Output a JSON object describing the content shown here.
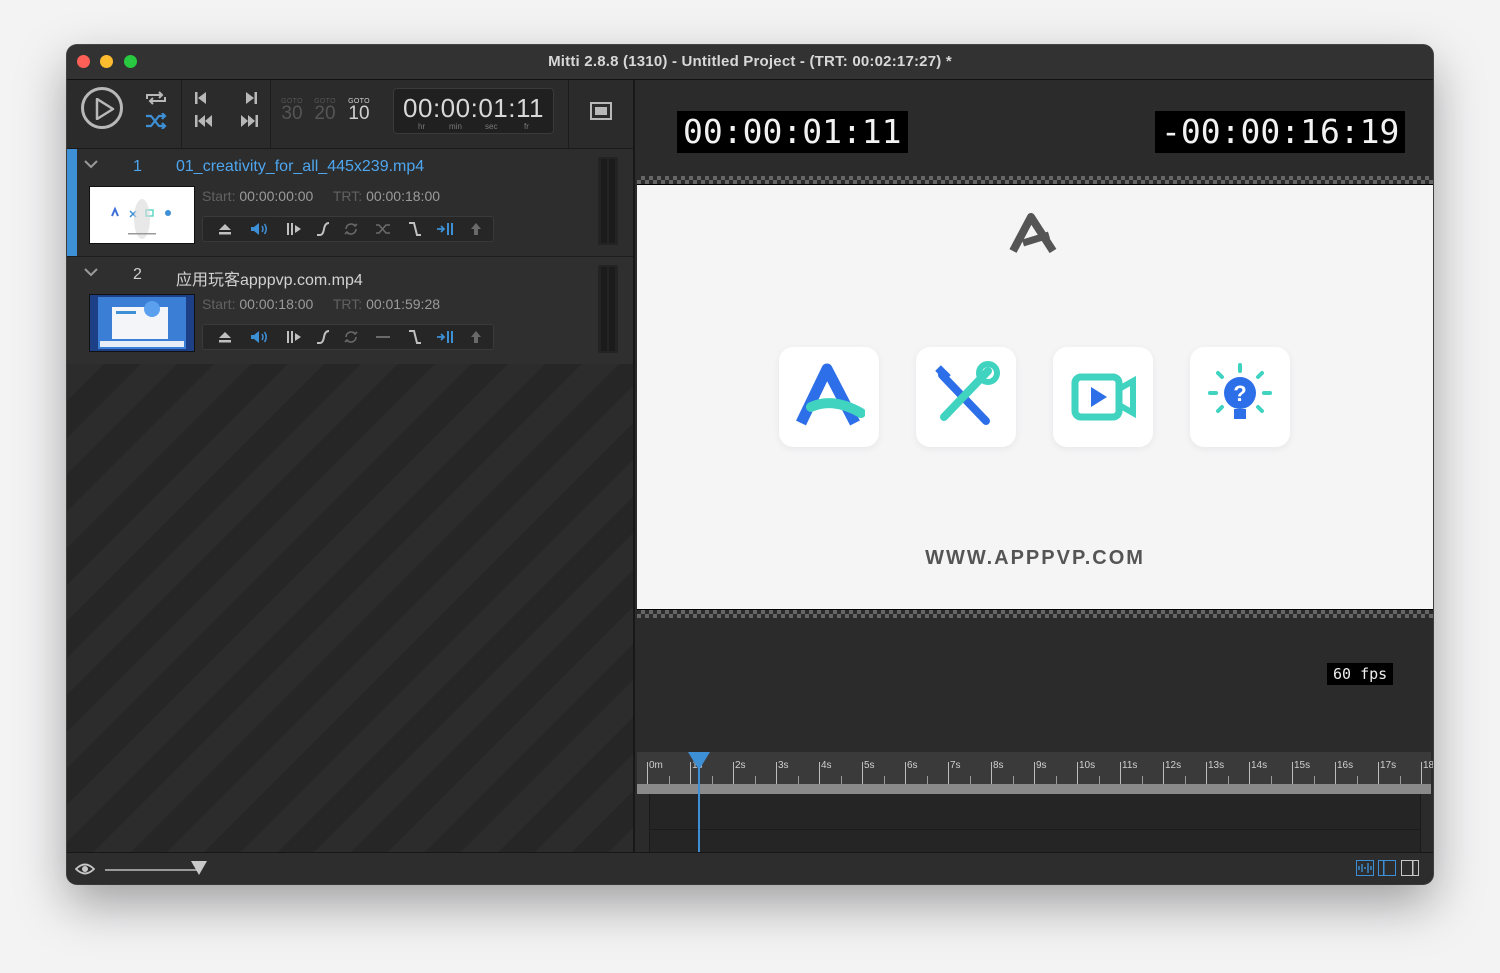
{
  "window": {
    "title": "Mitti 2.8.8 (1310) - Untitled Project - (TRT: 00:02:17:27) *"
  },
  "toolbar": {
    "goto": [
      {
        "label": "GOTO",
        "value": "30"
      },
      {
        "label": "GOTO",
        "value": "20"
      },
      {
        "label": "GOTO",
        "value": "10"
      }
    ],
    "timecode": "00:00:01:11",
    "units": {
      "hr": "hr",
      "min": "min",
      "sec": "sec",
      "fr": "fr"
    }
  },
  "cues": [
    {
      "number": "1",
      "filename": "01_creativity_for_all_445x239.mp4",
      "start_label": "Start:",
      "start": "00:00:00:00",
      "trt_label": "TRT:",
      "trt": "00:00:18:00",
      "selected": true
    },
    {
      "number": "2",
      "filename": "应用玩客apppvp.com.mp4",
      "start_label": "Start:",
      "start": "00:00:18:00",
      "trt_label": "TRT:",
      "trt": "00:01:59:28",
      "selected": false
    }
  ],
  "preview": {
    "elapsed": "00:00:01:11",
    "remaining": "-00:00:16:19",
    "video_url_text": "WWW.APPPVP.COM",
    "fps": "60 fps"
  },
  "timeline": {
    "labels": [
      "0m",
      "1s",
      "2s",
      "3s",
      "4s",
      "5s",
      "6s",
      "7s",
      "8s",
      "9s",
      "10s",
      "11s",
      "12s",
      "13s",
      "14s",
      "15s",
      "16s",
      "17s",
      "18"
    ],
    "playhead_seconds": 1.18,
    "visible_seconds": 18.5
  },
  "colors": {
    "accent": "#3d8fd6",
    "selected_text": "#4ea6ef",
    "window_bg": "#262626"
  },
  "icons": [
    "play-icon",
    "repeat-icon",
    "shuffle-icon",
    "previous-icon",
    "next-icon",
    "rewind-icon",
    "fast-forward-icon",
    "fullscreen-icon",
    "eye-icon"
  ]
}
